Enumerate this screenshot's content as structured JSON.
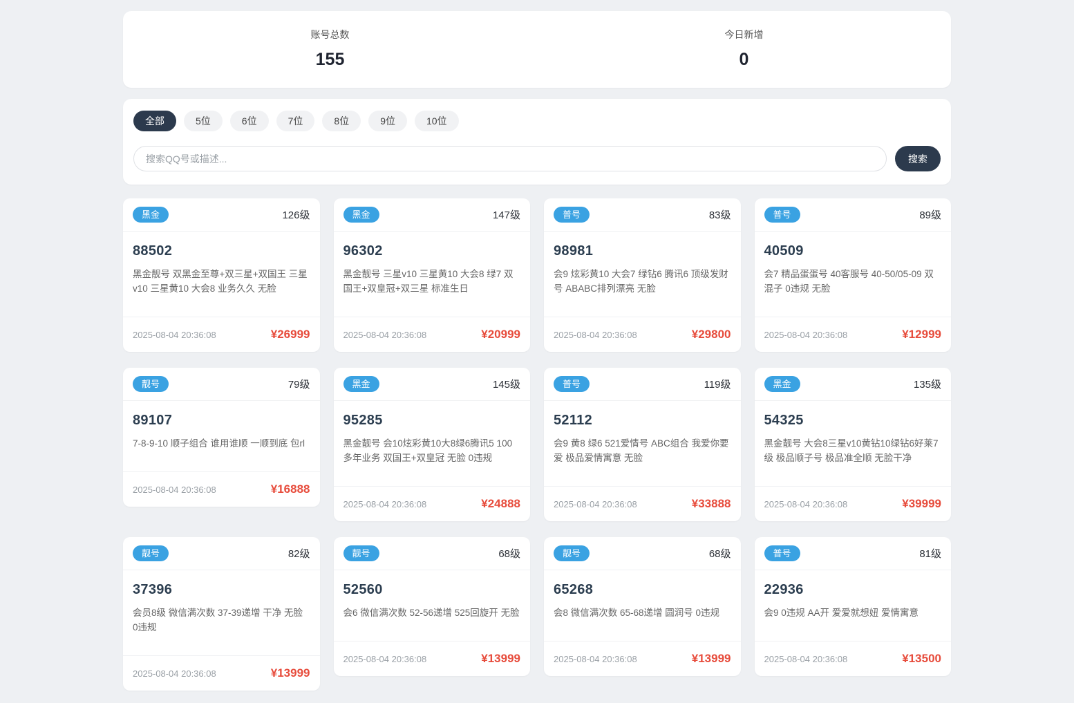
{
  "stats": {
    "total_label": "账号总数",
    "total_value": "155",
    "today_label": "今日新增",
    "today_value": "0"
  },
  "filters": {
    "tabs": [
      {
        "label": "全部",
        "active": true
      },
      {
        "label": "5位",
        "active": false
      },
      {
        "label": "6位",
        "active": false
      },
      {
        "label": "7位",
        "active": false
      },
      {
        "label": "8位",
        "active": false
      },
      {
        "label": "9位",
        "active": false
      },
      {
        "label": "10位",
        "active": false
      }
    ],
    "search_placeholder": "搜索QQ号或描述...",
    "search_button_label": "搜索"
  },
  "cards": [
    {
      "badge": "黑金",
      "level": "126级",
      "qq": "88502",
      "desc": "黑金靓号 双黑金至尊+双三星+双国王 三星v10 三星黄10 大会8 业务久久 无脸",
      "date": "2025-08-04 20:36:08",
      "price": "¥26999"
    },
    {
      "badge": "黑金",
      "level": "147级",
      "qq": "96302",
      "desc": "黑金靓号 三星v10 三星黄10 大会8 绿7 双国王+双皇冠+双三星 标准生日",
      "date": "2025-08-04 20:36:08",
      "price": "¥20999"
    },
    {
      "badge": "普号",
      "level": "83级",
      "qq": "98981",
      "desc": "会9 炫彩黄10 大会7 绿钻6 腾讯6 顶级发财号 ABABC排列漂亮 无脸",
      "date": "2025-08-04 20:36:08",
      "price": "¥29800"
    },
    {
      "badge": "普号",
      "level": "89级",
      "qq": "40509",
      "desc": "会7 精品蛋蛋号 40客服号 40-50/05-09 双混子 0违规 无脸",
      "date": "2025-08-04 20:36:08",
      "price": "¥12999"
    },
    {
      "badge": "靓号",
      "level": "79级",
      "qq": "89107",
      "desc": "7-8-9-10 顺子组合 谁用谁顺 一顺到底 包rl",
      "date": "2025-08-04 20:36:08",
      "price": "¥16888"
    },
    {
      "badge": "黑金",
      "level": "145级",
      "qq": "95285",
      "desc": "黑金靓号 会10炫彩黄10大8绿6腾讯5 100多年业务 双国王+双皇冠 无脸 0违规",
      "date": "2025-08-04 20:36:08",
      "price": "¥24888"
    },
    {
      "badge": "普号",
      "level": "119级",
      "qq": "52112",
      "desc": "会9 黄8 绿6 521爱情号 ABC组合 我爱你要爱 极品爱情寓意 无脸",
      "date": "2025-08-04 20:36:08",
      "price": "¥33888"
    },
    {
      "badge": "黑金",
      "level": "135级",
      "qq": "54325",
      "desc": "黑金靓号 大会8三星v10黄钻10绿钻6好莱7级 极品顺子号 极品准全顺 无脸干净",
      "date": "2025-08-04 20:36:08",
      "price": "¥39999"
    },
    {
      "badge": "靓号",
      "level": "82级",
      "qq": "37396",
      "desc": "会员8级 微信满次数 37-39递增 干净 无脸 0违规",
      "date": "2025-08-04 20:36:08",
      "price": "¥13999"
    },
    {
      "badge": "靓号",
      "level": "68级",
      "qq": "52560",
      "desc": "会6 微信满次数 52-56递增 525回旋开 无脸",
      "date": "2025-08-04 20:36:08",
      "price": "¥13999"
    },
    {
      "badge": "靓号",
      "level": "68级",
      "qq": "65268",
      "desc": "会8 微信满次数 65-68递增 圆润号 0违规",
      "date": "2025-08-04 20:36:08",
      "price": "¥13999"
    },
    {
      "badge": "普号",
      "level": "81级",
      "qq": "22936",
      "desc": "会9 0违规 AA开 爱爱就想妞 爱情寓意",
      "date": "2025-08-04 20:36:08",
      "price": "¥13500"
    }
  ],
  "colors": {
    "accent_blue": "#3aa2e2",
    "dark_navy": "#2c3a4d",
    "price_red": "#e74c3c",
    "page_background": "#eef0f3"
  }
}
